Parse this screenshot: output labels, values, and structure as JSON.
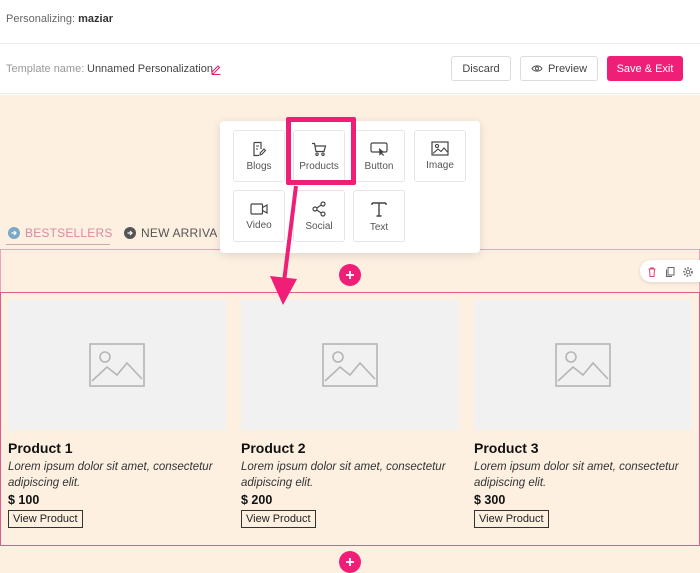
{
  "header": {
    "personalizing_label": "Personalizing:",
    "personalizing_user": "maziar"
  },
  "toolbar": {
    "template_label": "Template name:",
    "template_name": "Unnamed Personalization",
    "discard_label": "Discard",
    "preview_label": "Preview",
    "save_label": "Save & Exit"
  },
  "widgets": {
    "blogs": "Blogs",
    "products": "Products",
    "button": "Button",
    "image": "Image",
    "video": "Video",
    "social": "Social",
    "text": "Text"
  },
  "tabs": {
    "bestsellers": "BESTSELLERS",
    "new_arrivals": "NEW ARRIVA"
  },
  "products": [
    {
      "name": "Product 1",
      "description": "Lorem ipsum dolor sit amet, consectetur adipiscing elit.",
      "price": "$ 100",
      "button": "View Product"
    },
    {
      "name": "Product 2",
      "description": "Lorem ipsum dolor sit amet, consectetur adipiscing elit.",
      "price": "$ 200",
      "button": "View Product"
    },
    {
      "name": "Product 3",
      "description": "Lorem ipsum dolor sit amet, consectetur adipiscing elit.",
      "price": "$ 300",
      "button": "View Product"
    }
  ],
  "colors": {
    "accent": "#ef1f77",
    "canvas": "#fdf0e1"
  },
  "icons": [
    "pencil-icon",
    "eye-icon",
    "plus-icon",
    "trash-icon",
    "copy-icon",
    "gear-icon",
    "cart-icon",
    "image-icon",
    "video-icon",
    "share-icon",
    "text-icon",
    "blog-icon",
    "button-icon"
  ]
}
